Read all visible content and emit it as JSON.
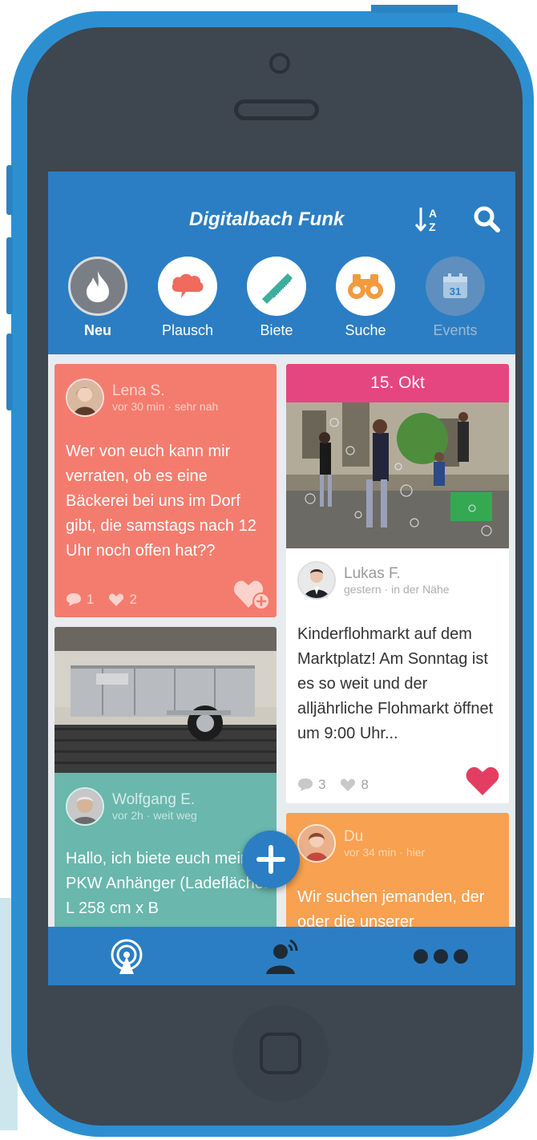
{
  "app": {
    "title": "Digitalbach Funk"
  },
  "categories": [
    {
      "label": "Neu",
      "icon": "flame-icon",
      "active": true
    },
    {
      "label": "Plausch",
      "icon": "chat-cloud-icon",
      "active": false
    },
    {
      "label": "Biete",
      "icon": "saw-icon",
      "active": false
    },
    {
      "label": "Suche",
      "icon": "binoculars-icon",
      "active": false
    },
    {
      "label": "Events",
      "icon": "calendar-icon",
      "calendar_day": "31",
      "active": false
    }
  ],
  "posts": [
    {
      "author": "Lena S.",
      "time": "vor 30 min",
      "distance": "sehr nah",
      "text": "Wer von euch kann mir verraten, ob es eine Bäckerei bei uns im Dorf gibt, die samstags nach 12 Uhr noch offen hat??",
      "comments": "1",
      "likes": "2",
      "color": "#f47c6e",
      "liked": false
    },
    {
      "date": "15. Okt",
      "author": "Lukas F.",
      "time": "gestern",
      "distance": "in der Nähe",
      "text": "Kinderflohmarkt auf dem Marktplatz! Am Sonntag ist es so weit und der alljährliche Flohmarkt öffnet um 9:00 Uhr...",
      "comments": "3",
      "likes": "8",
      "color": "#ffffff",
      "liked": true
    },
    {
      "author": "Wolfgang E.",
      "time": "vor 2h",
      "distance": "weit weg",
      "text": "Hallo, ich biete euch meinen PKW Anhänger (Ladefläche: L 258 cm x B",
      "color": "#69b7ad"
    },
    {
      "author": "Du",
      "time": "vor 34 min",
      "distance": "hier",
      "text": "Wir suchen jemanden, der oder die unserer",
      "color": "#f7a151"
    }
  ],
  "separator": "·",
  "toolbar": {
    "sort_icon": "sort-az-icon",
    "search_icon": "search-icon"
  },
  "tabbar": {
    "items": [
      "radio-broadcast-icon",
      "person-signal-icon",
      "more-dots-icon"
    ]
  },
  "colors": {
    "primary": "#2b7ec3",
    "phone_body": "#2e8fd0",
    "bezel": "#3e4650",
    "heart": "#e33e62"
  }
}
